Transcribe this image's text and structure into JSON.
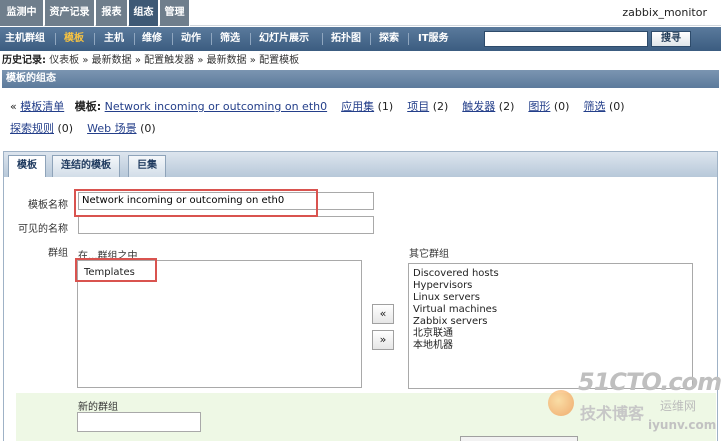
{
  "topnav": {
    "tabs": [
      {
        "label": "监测中",
        "active": false
      },
      {
        "label": "资产记录",
        "active": false
      },
      {
        "label": "报表",
        "active": false
      },
      {
        "label": "组态",
        "active": true
      },
      {
        "label": "管理",
        "active": false
      }
    ],
    "user": "zabbix_monitor"
  },
  "subnav": {
    "items": [
      {
        "label": "主机群组",
        "active": false
      },
      {
        "label": "模板",
        "active": true
      },
      {
        "label": "主机",
        "active": false
      },
      {
        "label": "维修",
        "active": false
      },
      {
        "label": "动作",
        "active": false
      },
      {
        "label": "筛选",
        "active": false
      },
      {
        "label": "幻灯片展示",
        "active": false
      },
      {
        "label": "拓扑图",
        "active": false
      },
      {
        "label": "探索",
        "active": false
      },
      {
        "label": "IT服务",
        "active": false
      }
    ],
    "search_value": "",
    "search_button": "搜寻"
  },
  "history": {
    "label": "历史记录:",
    "trail": "仪表板 » 最新数据 » 配置触发器 » 最新数据 » 配置模板"
  },
  "page_header": "模板的组态",
  "template_links": {
    "back_prefix": "«",
    "template_list": "模板清单",
    "template_label": "模板:",
    "template_name": "Network incoming or outcoming on eth0",
    "apps": {
      "label": "应用集",
      "count": "(1)"
    },
    "items": {
      "label": "项目",
      "count": "(2)"
    },
    "triggers": {
      "label": "触发器",
      "count": "(2)"
    },
    "graphs": {
      "label": "图形",
      "count": "(0)"
    },
    "screens": {
      "label": "筛选",
      "count": "(0)"
    },
    "discovery": {
      "label": "探索规则",
      "count": "(0)"
    },
    "web": {
      "label": "Web 场景",
      "count": "(0)"
    }
  },
  "form_tabs": [
    {
      "label": "模板",
      "active": true
    },
    {
      "label": "连结的模板",
      "active": false
    },
    {
      "label": "巨集",
      "active": false
    }
  ],
  "form": {
    "template_name_label": "模板名称",
    "template_name_value": "Network incoming or outcoming on eth0",
    "visible_name_label": "可见的名称",
    "visible_name_value": "",
    "groups_label": "群组",
    "in_groups_label": "在...群组之中",
    "other_groups_label": "其它群组",
    "in_groups": [
      "Templates"
    ],
    "other_groups": [
      "Discovered hosts",
      "Hypervisors",
      "Linux servers",
      "Virtual machines",
      "Zabbix servers",
      "北京联通",
      "本地机器"
    ],
    "move_left": "«",
    "move_right": "»",
    "new_group_label": "新的群组",
    "new_group_value": ""
  },
  "watermark": {
    "line1": "51CTO.com",
    "line2": "技术博客",
    "line3": "运维网",
    "line4": "iyunv.com"
  }
}
